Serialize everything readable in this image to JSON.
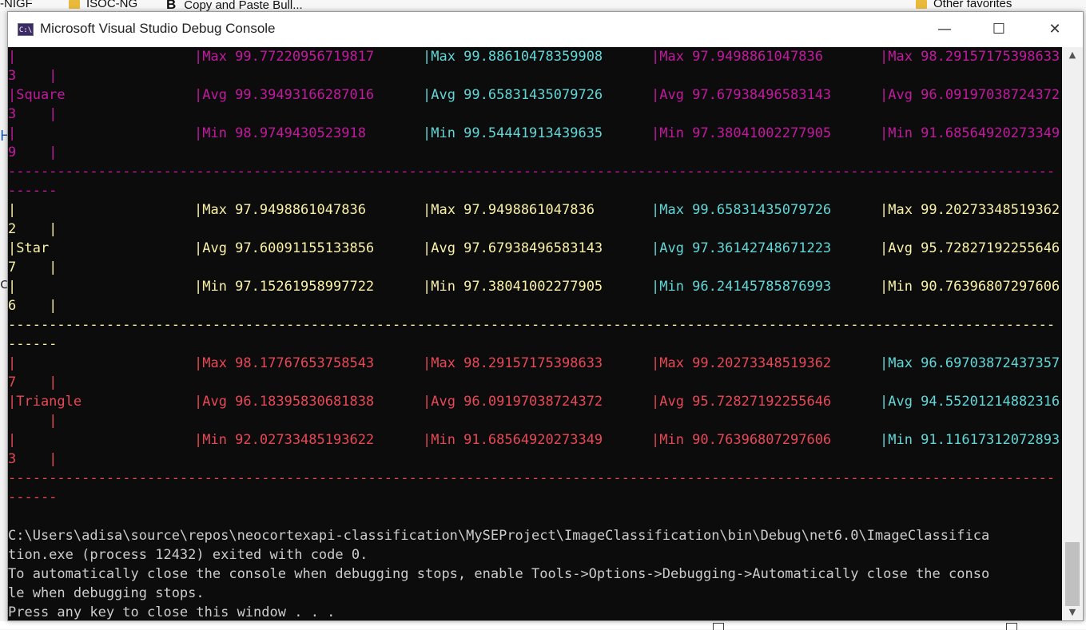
{
  "browser": {
    "bookmarks": [
      {
        "label": "-NIGF",
        "type": "partial"
      },
      {
        "label": "ISOC-NG",
        "type": "folder"
      },
      {
        "label": "Copy and Paste Bull...",
        "type": "link"
      },
      {
        "label": "Other favorites",
        "type": "folder"
      }
    ]
  },
  "window": {
    "title": "Microsoft Visual Studio Debug Console",
    "icon_text": "C:\\",
    "controls": {
      "minimize": "—",
      "maximize": "☐",
      "close": "✕"
    }
  },
  "colors": {
    "background": "#0c0c0c",
    "magenta": "#c2199f",
    "cyan": "#61d6d6",
    "yellow": "#f9f1a5",
    "red": "#e74856",
    "white": "#cccccc"
  },
  "console": {
    "separator": "--------------------------------------------------------------------------------------------------------------------------------",
    "separator_wrap": "------",
    "blocks": [
      {
        "color": "magenta",
        "rows": [
          {
            "first": "|",
            "cells": [
              {
                "text": "|Max 99.77220956719817",
                "color": "magenta"
              },
              {
                "text": "|Max 99.88610478359908",
                "color": "cyan"
              },
              {
                "text": "|Max 97.9498861047836",
                "color": "magenta"
              },
              {
                "text": "|Max 98.29157175398633",
                "color": "magenta"
              }
            ],
            "wrap": "3    |"
          },
          {
            "first": "|Square",
            "cells": [
              {
                "text": "|Avg 99.39493166287016",
                "color": "magenta"
              },
              {
                "text": "|Avg 99.65831435079726",
                "color": "cyan"
              },
              {
                "text": "|Avg 97.67938496583143",
                "color": "magenta"
              },
              {
                "text": "|Avg 96.09197038724372",
                "color": "magenta"
              }
            ],
            "wrap": "3    |"
          },
          {
            "first": "|",
            "cells": [
              {
                "text": "|Min 98.9749430523918",
                "color": "magenta"
              },
              {
                "text": "|Min 99.54441913439635",
                "color": "cyan"
              },
              {
                "text": "|Min 97.38041002277905",
                "color": "magenta"
              },
              {
                "text": "|Min 91.68564920273349",
                "color": "magenta"
              }
            ],
            "wrap": "9    |"
          }
        ]
      },
      {
        "color": "yellow",
        "rows": [
          {
            "first": "|",
            "cells": [
              {
                "text": "|Max 97.9498861047836",
                "color": "yellow"
              },
              {
                "text": "|Max 97.9498861047836",
                "color": "yellow"
              },
              {
                "text": "|Max 99.65831435079726",
                "color": "cyan"
              },
              {
                "text": "|Max 99.20273348519362",
                "color": "yellow"
              }
            ],
            "wrap": "2    |"
          },
          {
            "first": "|Star",
            "cells": [
              {
                "text": "|Avg 97.60091155133856",
                "color": "yellow"
              },
              {
                "text": "|Avg 97.67938496583143",
                "color": "yellow"
              },
              {
                "text": "|Avg 97.36142748671223",
                "color": "cyan"
              },
              {
                "text": "|Avg 95.72827192255646",
                "color": "yellow"
              }
            ],
            "wrap": "7    |"
          },
          {
            "first": "|",
            "cells": [
              {
                "text": "|Min 97.15261958997722",
                "color": "yellow"
              },
              {
                "text": "|Min 97.38041002277905",
                "color": "yellow"
              },
              {
                "text": "|Min 96.24145785876993",
                "color": "cyan"
              },
              {
                "text": "|Min 90.76396807297606",
                "color": "yellow"
              }
            ],
            "wrap": "6    |"
          }
        ]
      },
      {
        "color": "red",
        "rows": [
          {
            "first": "|",
            "cells": [
              {
                "text": "|Max 98.17767653758543",
                "color": "red"
              },
              {
                "text": "|Max 98.29157175398633",
                "color": "red"
              },
              {
                "text": "|Max 99.20273348519362",
                "color": "red"
              },
              {
                "text": "|Max 96.69703872437357",
                "color": "cyan"
              }
            ],
            "wrap": "7    |"
          },
          {
            "first": "|Triangle",
            "cells": [
              {
                "text": "|Avg 96.18395830681838",
                "color": "red"
              },
              {
                "text": "|Avg 96.09197038724372",
                "color": "red"
              },
              {
                "text": "|Avg 95.72827192255646",
                "color": "red"
              },
              {
                "text": "|Avg 94.55201214882316",
                "color": "cyan"
              }
            ],
            "wrap": "     |"
          },
          {
            "first": "|",
            "cells": [
              {
                "text": "|Min 92.02733485193622",
                "color": "red"
              },
              {
                "text": "|Min 91.68564920273349",
                "color": "red"
              },
              {
                "text": "|Min 90.76396807297606",
                "color": "red"
              },
              {
                "text": "|Min 91.11617312072893",
                "color": "cyan"
              }
            ],
            "wrap": "3    |"
          }
        ]
      }
    ],
    "footer_lines": [
      "C:\\Users\\adisa\\source\\repos\\neocortexapi-classification\\MySEProject\\ImageClassification\\bin\\Debug\\net6.0\\ImageClassifica",
      "tion.exe (process 12432) exited with code 0.",
      "To automatically close the console when debugging stops, enable Tools->Options->Debugging->Automatically close the conso",
      "le when debugging stops.",
      "Press any key to close this window . . ."
    ]
  }
}
